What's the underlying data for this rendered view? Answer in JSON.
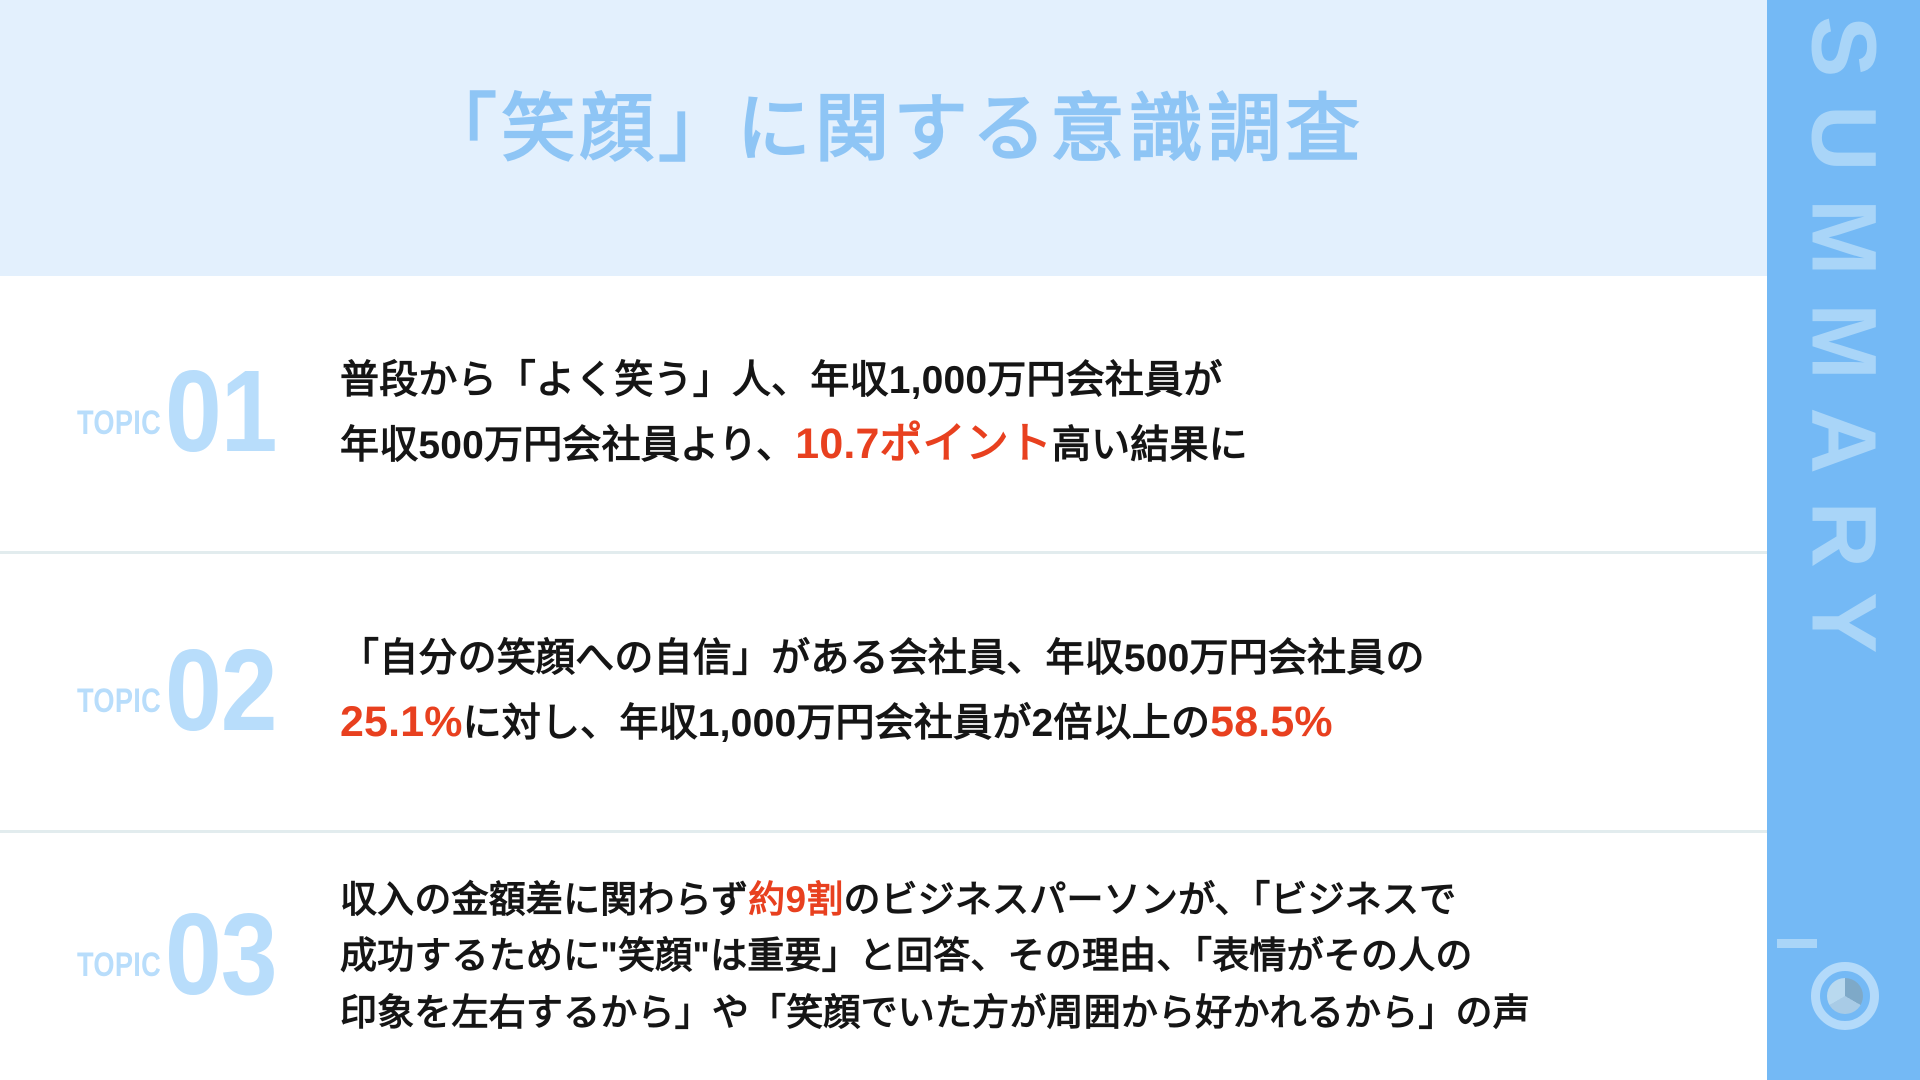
{
  "header": {
    "title": "「笑顔」に関する意識調査",
    "background_color": "#e3f0fd",
    "title_color": "#8ec5f5"
  },
  "sidebar": {
    "label": "SUMMARY",
    "background_color": "#74b9f5",
    "label_color": "#a9d5f8",
    "icon": "pie-chart-circle-icon"
  },
  "colors": {
    "accent_blue": "#b8ddfb",
    "highlight_red": "#e8401f",
    "divider": "#e2ecee",
    "body_text": "#151515"
  },
  "topics": [
    {
      "word": "TOPIC",
      "number": "01",
      "lines": [
        [
          {
            "text": "普段から「よく笑う」人、年収1,000万円会社員が",
            "style": "normal"
          }
        ],
        [
          {
            "text": "年収500万円会社員より、",
            "style": "normal"
          },
          {
            "text": "10.7ポイント",
            "style": "highlight-large"
          },
          {
            "text": "高い結果に",
            "style": "normal"
          }
        ]
      ]
    },
    {
      "word": "TOPIC",
      "number": "02",
      "lines": [
        [
          {
            "text": "「自分の笑顔への自信」がある会社員、年収500万円会社員の",
            "style": "normal"
          }
        ],
        [
          {
            "text": "25.1%",
            "style": "highlight-large"
          },
          {
            "text": "に対し、年収1,000万円会社員が2倍以上の",
            "style": "normal"
          },
          {
            "text": "58.5%",
            "style": "highlight-large"
          }
        ]
      ]
    },
    {
      "word": "TOPIC",
      "number": "03",
      "lines": [
        [
          {
            "text": "収入の金額差に関わらず",
            "style": "normal"
          },
          {
            "text": "約9割",
            "style": "highlight"
          },
          {
            "text": "のビジネスパーソンが、「ビジネスで",
            "style": "normal"
          }
        ],
        [
          {
            "text": "成功するために\"笑顔\"は重要」と回答、その理由、「表情がその人の",
            "style": "normal"
          }
        ],
        [
          {
            "text": "印象を左右するから」や「笑顔でいた方が周囲から好かれるから」の声",
            "style": "normal"
          }
        ]
      ]
    }
  ]
}
